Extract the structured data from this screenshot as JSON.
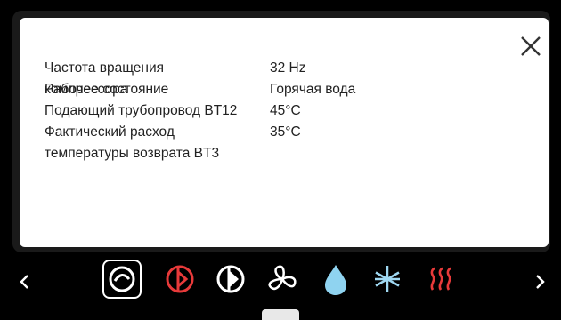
{
  "info_dialog": {
    "rows": [
      {
        "label": "Частота вращения компрессора",
        "value": "32 Hz"
      },
      {
        "label": "Рабочее состояние",
        "value": "Горячая вода"
      },
      {
        "label": "Подающий трубопровод BT12",
        "value": "45°C"
      },
      {
        "label": "Фактический расход температуры возврата BT3",
        "value": "35°C"
      }
    ],
    "close_icon": "close-icon"
  },
  "bottom_bar": {
    "icons": [
      {
        "name": "compressor-icon",
        "color": "#ffffff",
        "selected": true
      },
      {
        "name": "compressor-alarm-icon",
        "color": "#e83a3a",
        "selected": false
      },
      {
        "name": "heat-pump-icon",
        "color": "#ffffff",
        "selected": false
      },
      {
        "name": "fan-icon",
        "color": "#ffffff",
        "selected": false
      },
      {
        "name": "water-drop-icon",
        "color": "#8fd3f0",
        "selected": false
      },
      {
        "name": "cooling-snowflake-icon",
        "color": "#9fd8f2",
        "selected": false
      },
      {
        "name": "heating-icon",
        "color": "#e83a3a",
        "selected": false
      }
    ]
  }
}
